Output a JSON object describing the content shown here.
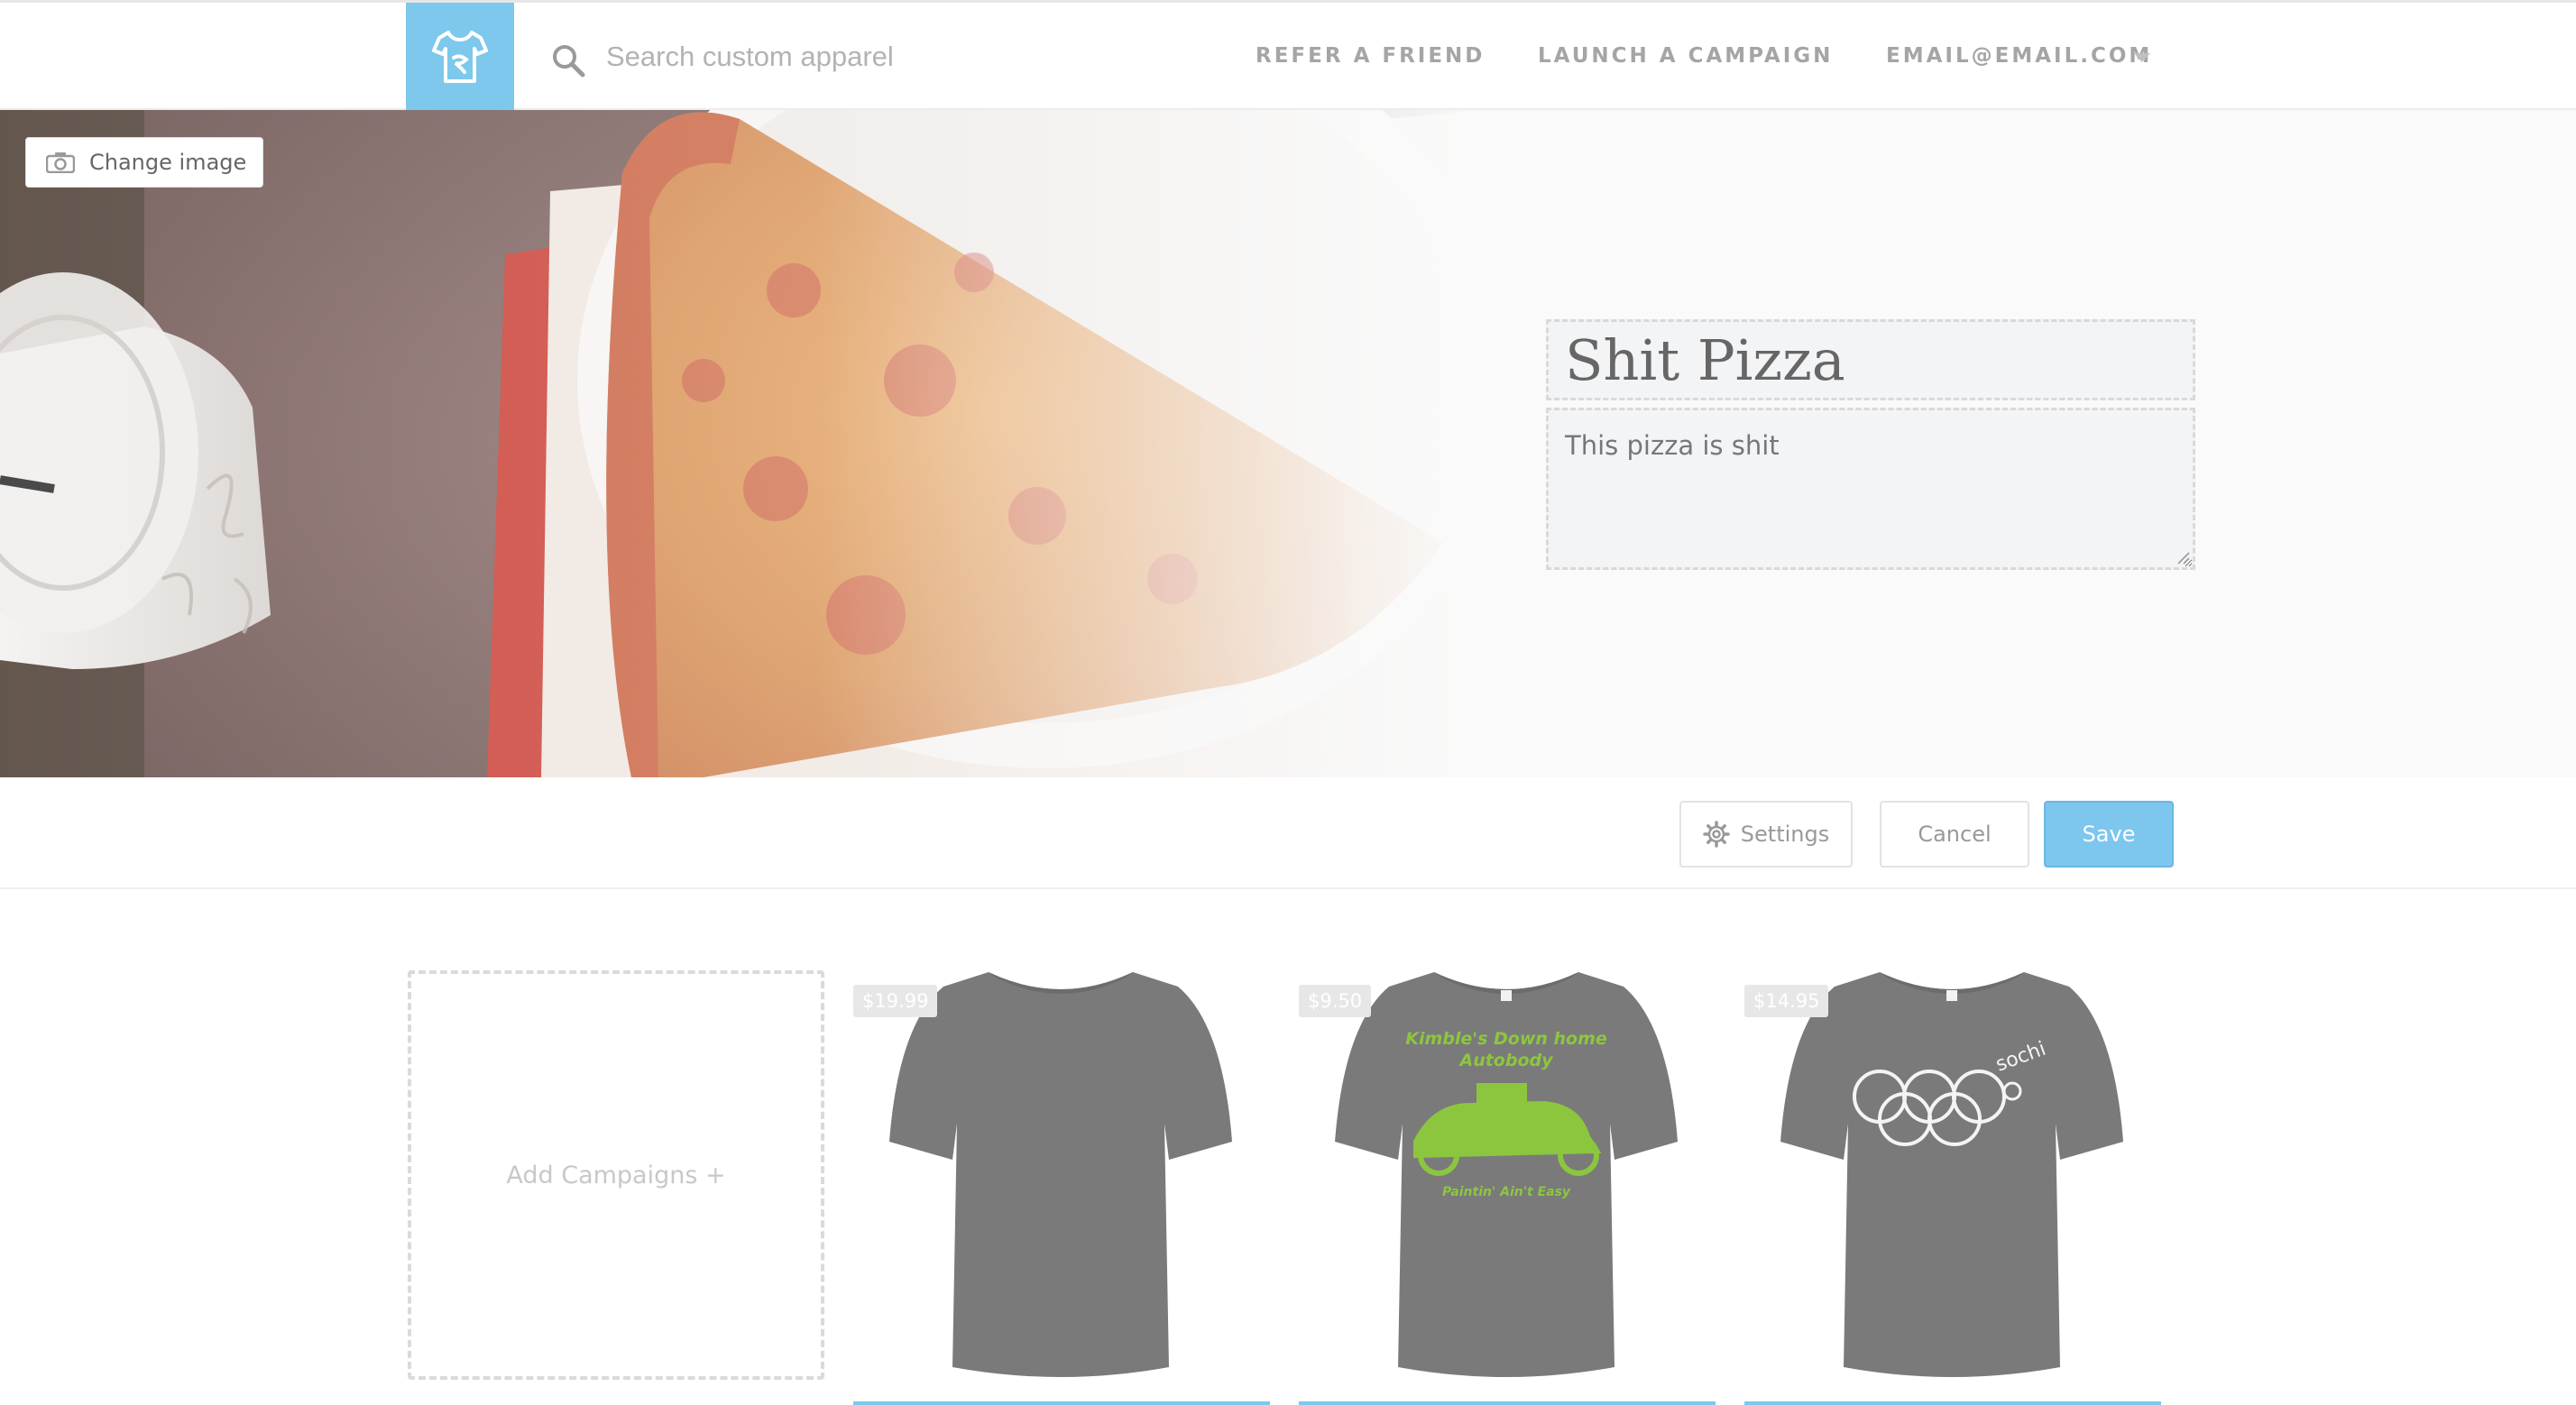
{
  "header": {
    "logo_icon": "tshirt-logo-icon",
    "search": {
      "placeholder": "Search custom apparel",
      "icon": "search-icon"
    },
    "nav": {
      "refer": "REFER A FRIEND",
      "launch": "LAUNCH A CAMPAIGN",
      "account": "EMAIL@EMAIL.COM"
    }
  },
  "hero": {
    "change_image_label": "Change image",
    "title": "Shit Pizza",
    "description": "This pizza is shit"
  },
  "actions": {
    "settings_label": "Settings",
    "cancel_label": "Cancel",
    "save_label": "Save"
  },
  "campaigns": {
    "add_label": "Add Campaigns +",
    "items": [
      {
        "price": "$19.99",
        "design": "plain"
      },
      {
        "price": "$9.50",
        "design": "autobody",
        "line1": "Kimble's Down home",
        "line2": "Autobody",
        "line3": "Paintin' Ain't Easy"
      },
      {
        "price": "$14.95",
        "design": "rings",
        "mark": "sochi"
      }
    ]
  },
  "colors": {
    "accent": "#7dc8ec",
    "shirt": "#777777",
    "print_green": "#8cc63f",
    "nav_text": "#a5a5a5"
  }
}
